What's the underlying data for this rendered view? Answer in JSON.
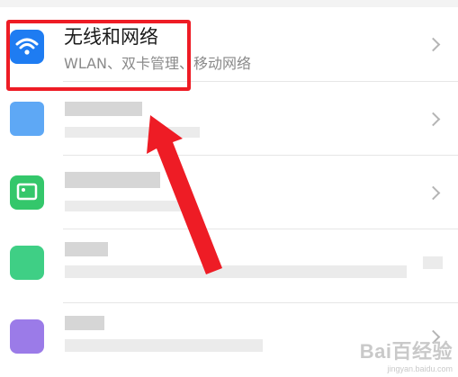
{
  "settings": {
    "wireless": {
      "title": "无线和网络",
      "subtitle": "WLAN、双卡管理、移动网络",
      "icon": "wifi-icon",
      "icon_color": "#1e7cf2"
    },
    "blurred_rows": [
      {
        "icon_color": "#5ea8f5"
      },
      {
        "icon_color": "#34c76b"
      },
      {
        "icon_color": "#3fcf85"
      },
      {
        "icon_color": "#9b7be8"
      }
    ]
  },
  "annotation": {
    "highlight_color": "#ee1c25",
    "arrow_color": "#ee1c25"
  },
  "watermark": {
    "main": "Bai百经验",
    "sub": "jingyan.baidu.com"
  }
}
